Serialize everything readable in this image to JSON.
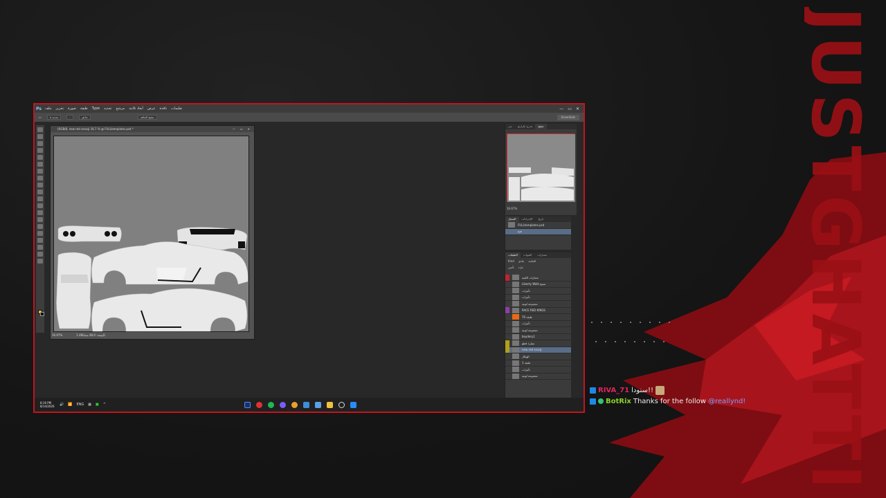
{
  "overlay": {
    "brand_text": "JUSTGHATTIN",
    "accent_color": "#c4151e"
  },
  "app": {
    "logo": "Ps",
    "menus": [
      "ملف",
      "تحرير",
      "صورة",
      "طبقة",
      "Type",
      "تحديد",
      "مرشح",
      "أبعاد ثلاثية",
      "عرض",
      "نافذة",
      "تعليمات"
    ],
    "window_controls": [
      "—",
      "▭",
      "✕"
    ],
    "options": {
      "feather_label": "تحديد ٥",
      "px_value": "٠",
      "style_label": "عادي",
      "refine_button": "تنقيح الحافة",
      "workspace": "Essentials"
    },
    "document": {
      "title": "(RGB/8, new red ssssq) 16.7 % @ FULLtemplates.psd *",
      "zoom": "16.67%",
      "doc_size": "وثيقة: 48.0 ميجا/1.48G",
      "controls": [
        "—",
        "▭",
        "✕"
      ]
    },
    "navigator": {
      "tabs": [
        "تنى",
        "مدرج تكراري",
        "تنقيح"
      ],
      "zoom": "16.67%"
    },
    "history": {
      "tabs": [
        "السجل",
        "الإجراءات",
        "تاريخ"
      ],
      "items": [
        "FULLtemplates.psd",
        "فتح"
      ]
    },
    "layers": {
      "tabs": [
        "الطبقات",
        "القنوات",
        "مسارات"
      ],
      "kind_label": "Kind",
      "mode_label": "عادي",
      "opacity_label": "العتامة",
      "lock_label": "تأمين",
      "fill_label": "ملء",
      "rows": [
        {
          "name": "شعارات الكبية",
          "color": "#c4222e"
        },
        {
          "name": "Liberty Walk نسيج",
          "color": ""
        },
        {
          "name": "تأثيرات",
          "color": ""
        },
        {
          "name": "تأثيرات",
          "color": ""
        },
        {
          "name": "مجموعة لونية",
          "color": ""
        },
        {
          "name": "RACE RED KINGS",
          "color": "#8a3fa7"
        },
        {
          "name": "طبقة 70",
          "color": ""
        },
        {
          "name": "تأثيرات",
          "color": ""
        },
        {
          "name": "مجموعة لونية",
          "color": ""
        },
        {
          "name": "boydery1",
          "color": ""
        },
        {
          "name": "سيارة قطع",
          "color": "#b0a01a"
        },
        {
          "name": "new red ssssq",
          "color": "#b0a01a"
        },
        {
          "name": "الهيكل",
          "color": ""
        },
        {
          "name": "طبقة 1",
          "color": ""
        },
        {
          "name": "تأثيرات",
          "color": ""
        },
        {
          "name": "مجموعة لونية",
          "color": ""
        }
      ]
    },
    "taskbar": {
      "time": "8:16 PM",
      "date": "8/14/2026",
      "lang": "ENG",
      "caret": "^"
    }
  },
  "chat": [
    {
      "user": "RIVA_71",
      "message": "سنودا!!",
      "user_color": "#e0245e"
    },
    {
      "user": "BotRix",
      "message": "Thanks for the follow",
      "mention": "@reallynd!",
      "user_color": "#8cd12c"
    }
  ]
}
